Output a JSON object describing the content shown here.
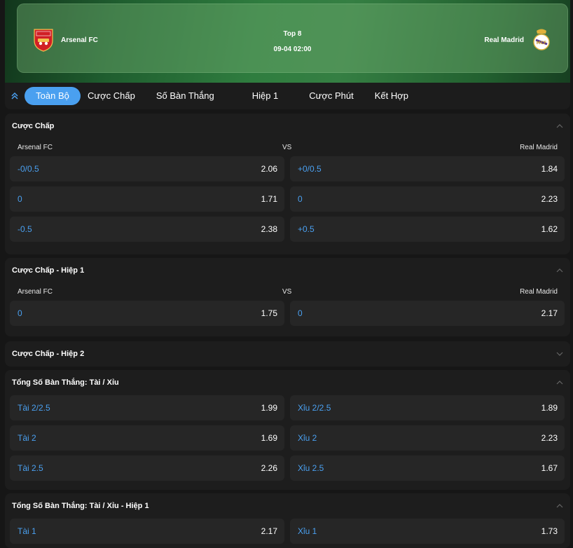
{
  "match": {
    "home_team": "Arsenal FC",
    "away_team": "Real Madrid",
    "stage": "Top 8",
    "datetime": "09-04 02:00"
  },
  "tabs": [
    "Toàn Bộ",
    "Cược Chấp",
    "Số Bàn Thắng",
    "Hiệp 1",
    "Cược Phút",
    "Kết Hợp"
  ],
  "active_tab": 0,
  "colors": {
    "accent": "#4aa0f0",
    "panel": "#1d1d1d",
    "cell": "#262626",
    "page": "#161616"
  },
  "icons": {
    "collapse": "double-chevron-up-icon",
    "expanded": "chevron-up-icon",
    "collapsed": "chevron-down-icon"
  },
  "markets": [
    {
      "title": "Cược Chấp",
      "expanded": true,
      "header": {
        "home": "Arsenal FC",
        "vs": "VS",
        "away": "Real Madrid"
      },
      "rows": [
        [
          {
            "label": "-0/0.5",
            "odd": "2.06"
          },
          {
            "label": "+0/0.5",
            "odd": "1.84"
          }
        ],
        [
          {
            "label": "0",
            "odd": "1.71"
          },
          {
            "label": "0",
            "odd": "2.23"
          }
        ],
        [
          {
            "label": "-0.5",
            "odd": "2.38"
          },
          {
            "label": "+0.5",
            "odd": "1.62"
          }
        ]
      ]
    },
    {
      "title": "Cược Chấp - Hiệp 1",
      "expanded": true,
      "header": {
        "home": "Arsenal FC",
        "vs": "VS",
        "away": "Real Madrid"
      },
      "rows": [
        [
          {
            "label": "0",
            "odd": "1.75"
          },
          {
            "label": "0",
            "odd": "2.17"
          }
        ]
      ]
    },
    {
      "title": "Cược Chấp - Hiệp 2",
      "expanded": false,
      "rows": []
    },
    {
      "title": "Tổng Số Bàn Thắng: Tài / Xỉu",
      "expanded": true,
      "rows": [
        [
          {
            "label": "Tài 2/2.5",
            "odd": "1.99"
          },
          {
            "label": "Xỉu 2/2.5",
            "odd": "1.89"
          }
        ],
        [
          {
            "label": "Tài 2",
            "odd": "1.69"
          },
          {
            "label": "Xỉu 2",
            "odd": "2.23"
          }
        ],
        [
          {
            "label": "Tài 2.5",
            "odd": "2.26"
          },
          {
            "label": "Xỉu 2.5",
            "odd": "1.67"
          }
        ]
      ]
    },
    {
      "title": "Tổng Số Bàn Thắng: Tài / Xỉu - Hiệp 1",
      "expanded": true,
      "rows": [
        [
          {
            "label": "Tài 1",
            "odd": "2.17"
          },
          {
            "label": "Xỉu 1",
            "odd": "1.73"
          }
        ]
      ]
    }
  ]
}
